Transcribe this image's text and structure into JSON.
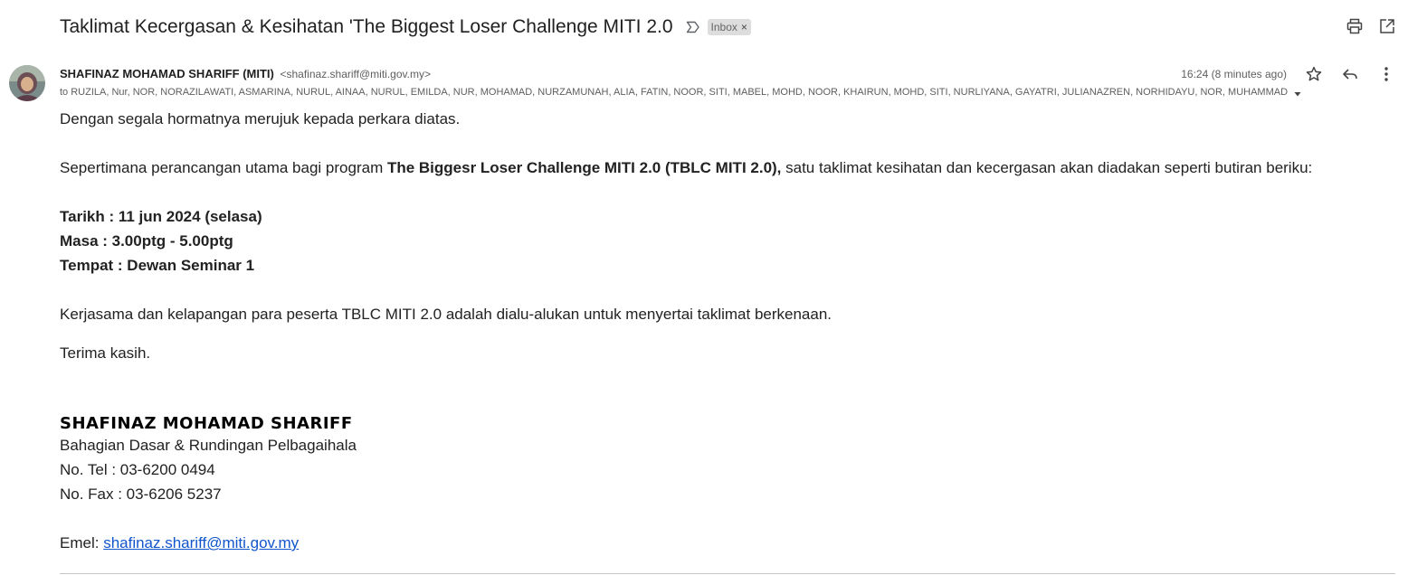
{
  "header": {
    "subject": "Taklimat Kecergasan & Kesihatan 'The Biggest Loser Challenge MITI 2.0",
    "label": "Inbox",
    "label_remove": "×"
  },
  "message": {
    "sender_name": "SHAFINAZ MOHAMAD SHARIFF (MITI)",
    "sender_email": "<shafinaz.shariff@miti.gov.my>",
    "timestamp": "16:24 (8 minutes ago)",
    "to_line": "to RUZILA, Nur, NOR, NORAZILAWATI, ASMARINA, NURUL, AINAA, NURUL, EMILDA, NUR, MOHAMAD, NURZAMUNAH, ALIA, FATIN, NOOR, SITI, MABEL, MOHD, NOOR, KHAIRUN, MOHD, SITI, NURLIYANA, GAYATRI, JULIANAZREN, NORHIDAYU, NOR, MUHAMMAD"
  },
  "body": {
    "greeting": "Dengan segala hormatnya merujuk kepada perkara diatas.",
    "para1_pre": "Sepertimana perancangan utama bagi program ",
    "para1_bold": "The Biggesr Loser Challenge MITI 2.0 (TBLC MITI 2.0),",
    "para1_post": " satu taklimat kesihatan dan kecergasan akan diadakan seperti butiran beriku:",
    "date": "Tarikh : 11 jun 2024 (selasa)",
    "time": "Masa : 3.00ptg - 5.00ptg",
    "venue": "Tempat : Dewan Seminar 1",
    "para2": "Kerjasama dan kelapangan para peserta TBLC MITI 2.0 adalah dialu-alukan untuk menyertai taklimat berkenaan.",
    "thanks": "Terima kasih."
  },
  "signature": {
    "name": "SHAFINAZ MOHAMAD SHARIFF",
    "department": "Bahagian Dasar & Rundingan Pelbagaihala",
    "tel": "No. Tel : 03-6200 0494",
    "fax": "No. Fax : 03-6206 5237",
    "email_label": "Emel: ",
    "email": "shafinaz.shariff@miti.gov.my"
  },
  "icons": {
    "importance": "importance-marker-icon",
    "print": "print-icon",
    "open_new_window": "open-in-new-window-icon",
    "star": "star-icon",
    "reply": "reply-icon",
    "more": "more-vertical-icon",
    "show_details": "chevron-down-icon"
  },
  "colors": {
    "link": "#1155cc",
    "label_bg": "#dddddd",
    "text": "#222222",
    "muted": "#5e5e5e"
  }
}
